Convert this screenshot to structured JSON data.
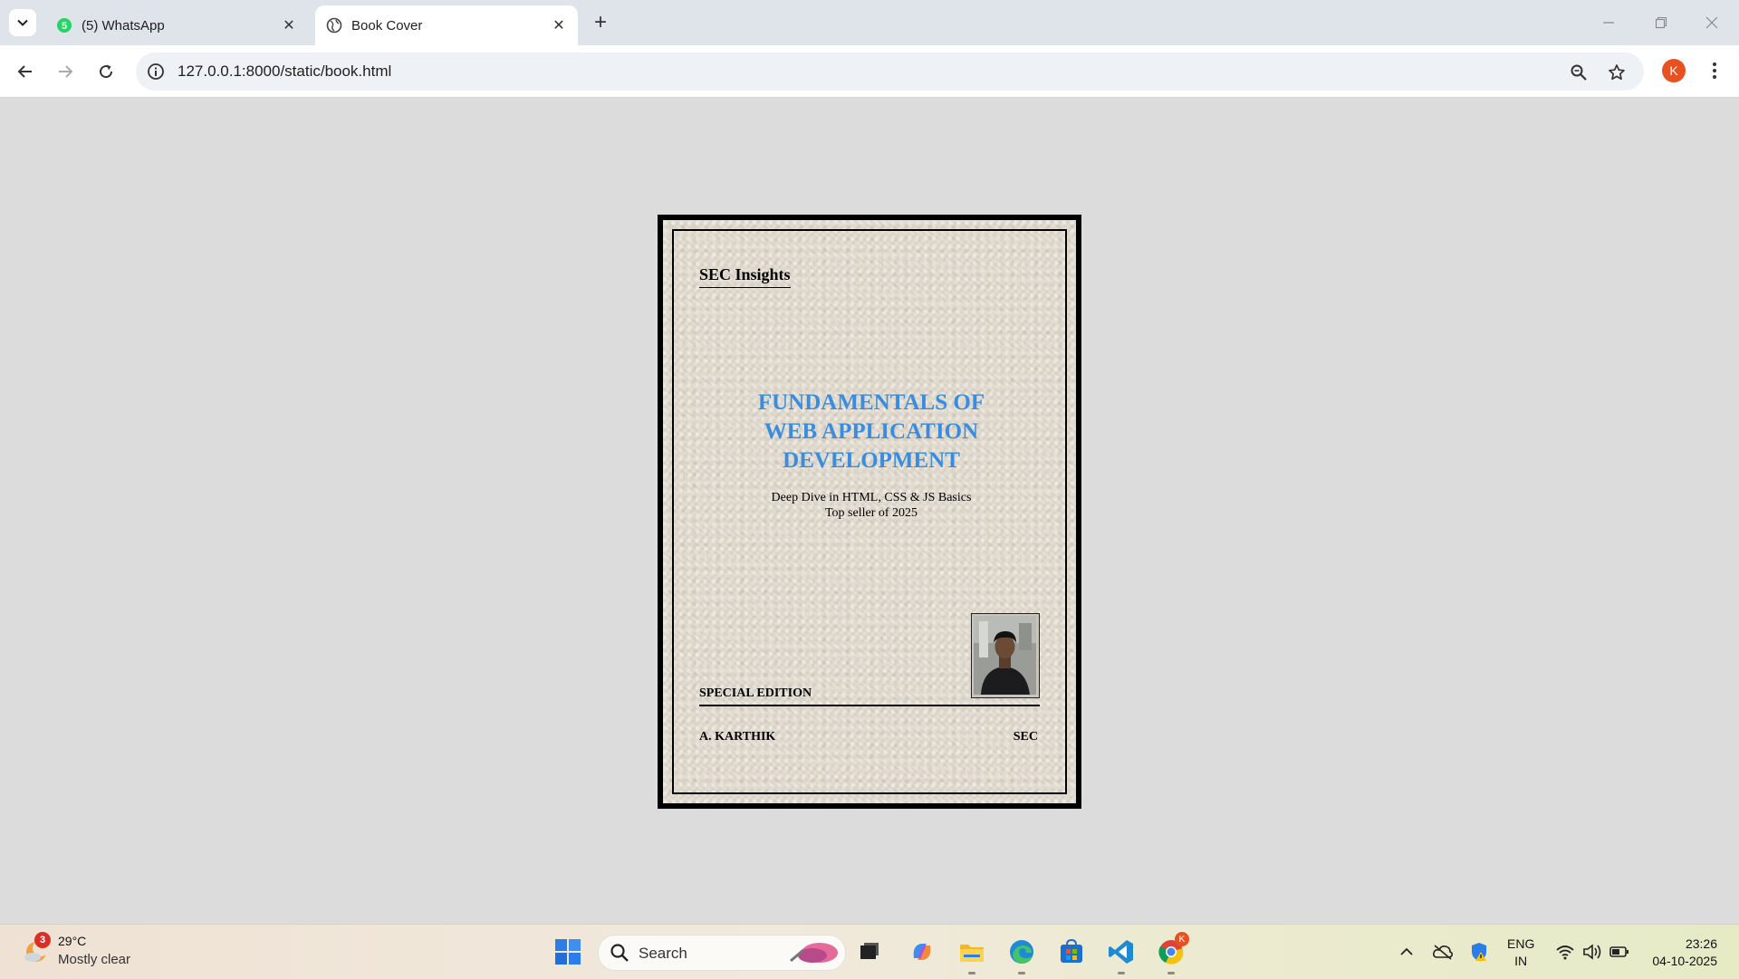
{
  "browser": {
    "tabs": [
      {
        "title": "(5) WhatsApp",
        "badge": "5"
      },
      {
        "title": "Book Cover"
      }
    ],
    "url": "127.0.0.1:8000/static/book.html",
    "profile_initial": "K",
    "colors": {
      "accent_profile": "#e8511f",
      "whatsapp": "#25d366"
    }
  },
  "book": {
    "publisher": "SEC Insights",
    "title_lines": [
      "FUNDAMENTALS OF",
      "WEB APPLICATION",
      "DEVELOPMENT"
    ],
    "subtitle": "Deep Dive in HTML, CSS & JS Basics",
    "tagline": "Top seller of 2025",
    "edition": "SPECIAL EDITION",
    "author": "A. KARTHIK",
    "organization": "SEC",
    "colors": {
      "title": "#3a8dde",
      "paper": "#e3dcd0",
      "border": "#000000"
    }
  },
  "taskbar": {
    "weather": {
      "temp": "29°C",
      "desc": "Mostly clear",
      "badge": "3"
    },
    "search_label": "Search",
    "chrome_badge": "K",
    "language": {
      "line1": "ENG",
      "line2": "IN"
    },
    "clock": {
      "time": "23:26",
      "date": "04-10-2025"
    }
  }
}
